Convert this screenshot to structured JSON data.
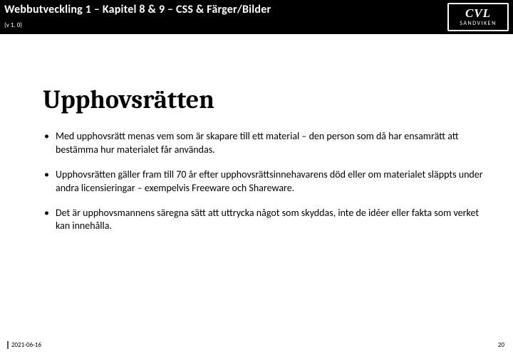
{
  "header": {
    "title": "Webbutveckling 1  – Kapitel 8 & 9 – CSS & Färger/Bilder",
    "version": "(v 1. 0)"
  },
  "logo": {
    "top": "CVL",
    "sub": "SANDVIKEN"
  },
  "content": {
    "title": "Upphovsrätten",
    "bullets": [
      "Med upphovsrätt menas vem som är skapare till ett material – den person som då har ensamrätt att bestämma hur materialet får användas.",
      "Upphovsrätten gäller fram till 70 år efter upphovsrättsinnehavarens död eller om materialet släppts under andra licensieringar – exempelvis Freeware och Shareware.",
      "Det är upphovsmannens säregna sätt att uttrycka något som skyddas, inte de idéer eller fakta som verket kan innehålla."
    ]
  },
  "footer": {
    "date": "2021-06-16",
    "page": "20"
  }
}
